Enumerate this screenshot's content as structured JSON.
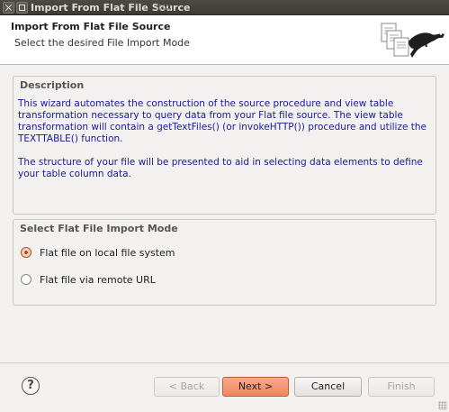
{
  "window": {
    "title": "Import From Flat File Source"
  },
  "header": {
    "title": "Import From Flat File Source",
    "subtitle": "Select the desired File Import Mode",
    "icon": "teiid-wizard-icon"
  },
  "description": {
    "group_title": "Description",
    "paragraph1": "This wizard automates the construction of the source procedure and view table transformation necessary to query data from your Flat file source. The view table transformation will contain a getTextFiles() (or invokeHTTP()) procedure and utilize the TEXTTABLE() function.",
    "paragraph2": "The structure of your file will be presented to aid in selecting data elements to define your table column data."
  },
  "mode": {
    "group_title": "Select Flat File Import Mode",
    "options": [
      {
        "label": "Flat file on local file system",
        "selected": true
      },
      {
        "label": "Flat file via remote URL",
        "selected": false
      }
    ]
  },
  "buttons": {
    "help": "?",
    "back": "< Back",
    "next": "Next >",
    "cancel": "Cancel",
    "finish": "Finish"
  },
  "colors": {
    "accent": "#ee8560",
    "description_text": "#1a1a9a",
    "titlebar": "#3b3a36"
  }
}
